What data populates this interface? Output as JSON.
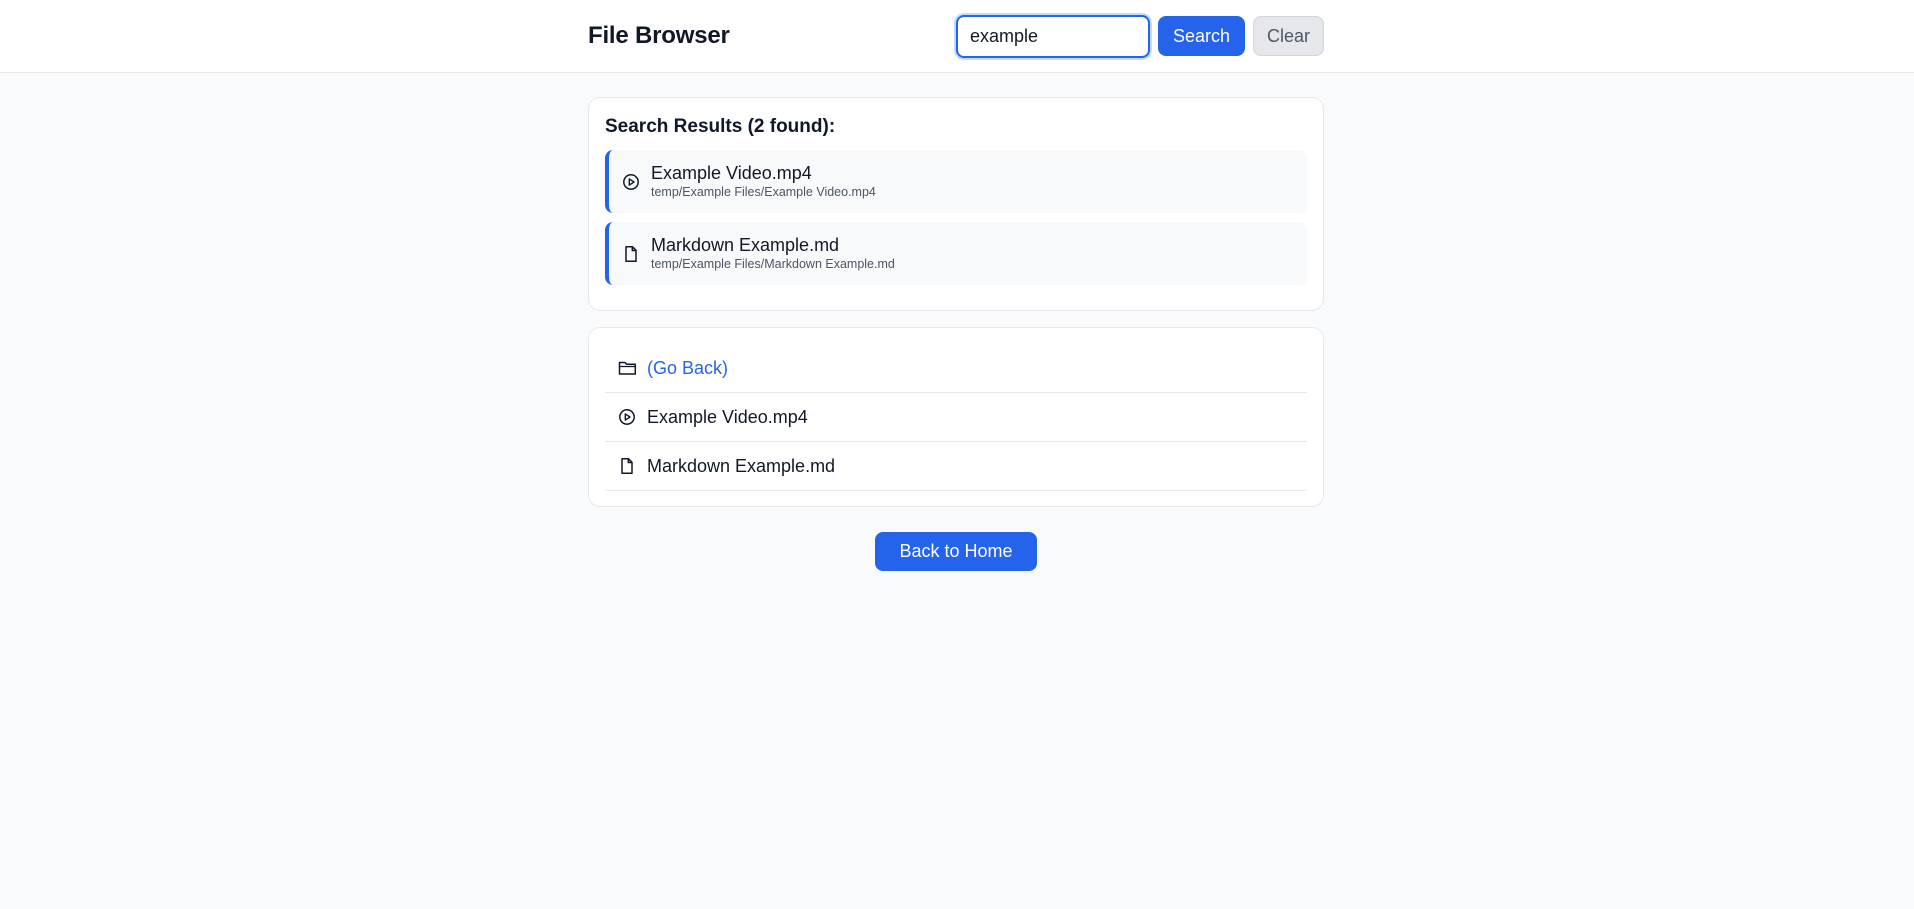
{
  "header": {
    "title": "File Browser",
    "search_value": "example",
    "search_label": "Search",
    "clear_label": "Clear"
  },
  "results": {
    "title": "Search Results (2 found):",
    "items": [
      {
        "name": "Example Video.mp4",
        "path": "temp/Example Files/Example Video.mp4",
        "icon": "play-circle-icon"
      },
      {
        "name": "Markdown Example.md",
        "path": "temp/Example Files/Markdown Example.md",
        "icon": "file-icon"
      }
    ]
  },
  "directory": {
    "items": [
      {
        "label": "(Go Back)",
        "icon": "folder-icon"
      },
      {
        "label": "Example Video.mp4",
        "icon": "play-circle-icon"
      },
      {
        "label": "Markdown Example.md",
        "icon": "file-icon"
      }
    ]
  },
  "footer": {
    "home_label": "Back to Home"
  },
  "colors": {
    "accent": "#2563eb",
    "background": "#f8fafc",
    "card": "#ffffff",
    "border": "#e5e7eb"
  }
}
